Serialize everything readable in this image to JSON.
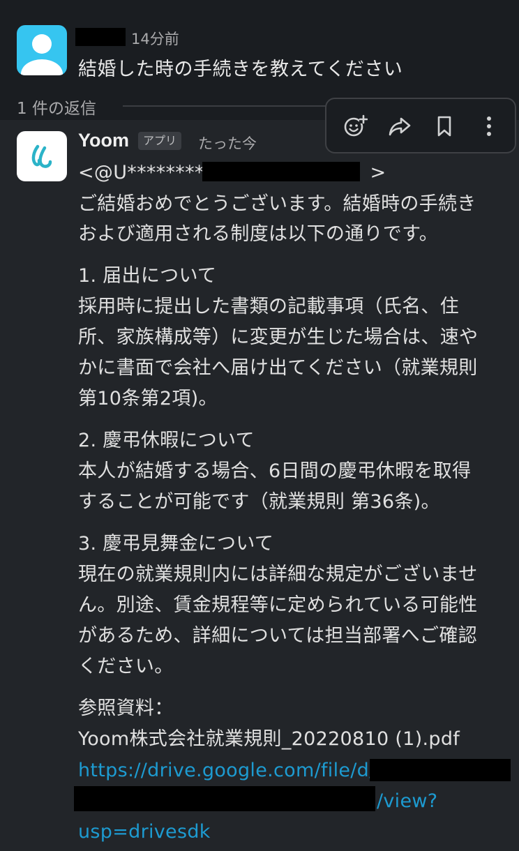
{
  "message_user": {
    "time": "14分前",
    "text": "結婚した時の手続きを教えてください"
  },
  "thread": {
    "replies_label": "1 件の返信"
  },
  "message_bot": {
    "name": "Yoom",
    "badge": "アプリ",
    "time": "たった今",
    "mention_prefix": "<@U*********",
    "mention_suffix": ">",
    "lines": [
      "ご結婚おめでとうございます。結婚時の手続き",
      "および適用される制度は以下の通りです。",
      "1. 届出について",
      "採用時に提出した書類の記載事項（氏名、住",
      "所、家族構成等）に変更が生じた場合は、速や",
      "かに書面で会社へ届け出てください（就業規則",
      "第10条第2項)。",
      "2. 慶弔休暇について",
      "本人が結婚する場合、6日間の慶弔休暇を取得",
      "することが可能です（就業規則 第36条)。",
      "3. 慶弔見舞金について",
      "現在の就業規則内には詳細な規定がございませ",
      "ん。別途、賃金規程等に定められている可能性",
      "があるため、詳細については担当部署へご確認",
      "ください。",
      "参照資料：",
      "Yoom株式会社就業規則_20220810 (1).pdf"
    ],
    "link_start": "https://drive.google.com/file/d/",
    "link_mid": "/view?",
    "link_end": "usp=drivesdk"
  },
  "toolbar": {
    "icons": [
      "add-reaction-icon",
      "forward-icon",
      "bookmark-icon",
      "more-icon"
    ]
  },
  "colors": {
    "background": "#1a1d21",
    "hover_background": "#222529",
    "link": "#1d9bd1",
    "avatar_user": "#36c5f0",
    "bot_logo": "#2bb3c8"
  }
}
